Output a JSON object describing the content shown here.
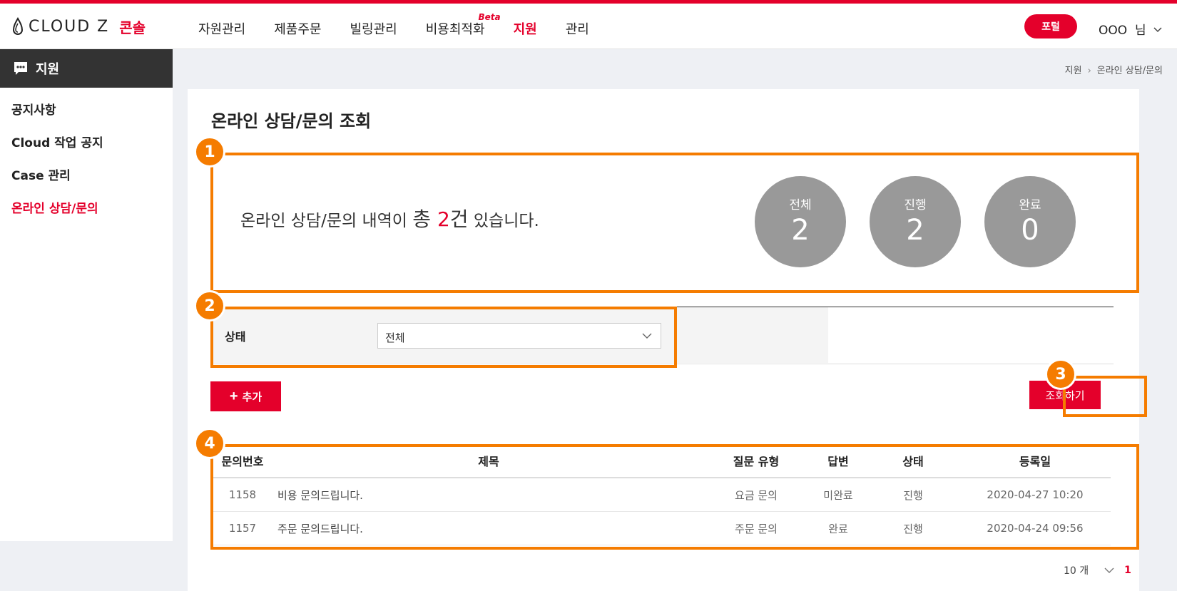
{
  "header": {
    "logo_text": "CLOUD Z",
    "logo_sub": "콘솔",
    "nav": [
      {
        "label": "자원관리"
      },
      {
        "label": "제품주문"
      },
      {
        "label": "빌링관리"
      },
      {
        "label": "비용최적화",
        "badge": "Beta"
      },
      {
        "label": "지원",
        "active": true
      },
      {
        "label": "관리"
      }
    ],
    "portal_label": "포털",
    "user_label": "OOO  님"
  },
  "sidebar": {
    "title": "지원",
    "items": [
      {
        "label": "공지사항"
      },
      {
        "label": "Cloud 작업 공지"
      },
      {
        "label": "Case 관리"
      },
      {
        "label": "온라인 상담/문의",
        "active": true
      }
    ]
  },
  "breadcrumb": {
    "parent": "지원",
    "current": "온라인 상담/문의"
  },
  "main": {
    "title": "온라인 상담/문의 조회",
    "summary": {
      "prefix": "온라인 상담/문의 내역이 ",
      "total_word": "총 ",
      "count": "2",
      "unit": "건",
      "suffix": " 있습니다."
    },
    "stats": [
      {
        "label": "전체",
        "value": "2"
      },
      {
        "label": "진행",
        "value": "2"
      },
      {
        "label": "완료",
        "value": "0"
      }
    ],
    "filter": {
      "label": "상태",
      "selected": "전체"
    },
    "add_label": "추가",
    "search_label": "조회하기",
    "table": {
      "columns": [
        "문의번호",
        "제목",
        "질문 유형",
        "답변",
        "상태",
        "등록일"
      ],
      "rows": [
        [
          "1158",
          "비용 문의드립니다.",
          "요금 문의",
          "미완료",
          "진행",
          "2020-04-27 10:20"
        ],
        [
          "1157",
          "주문 문의드립니다.",
          "주문 문의",
          "완료",
          "진행",
          "2020-04-24 09:56"
        ]
      ]
    },
    "pager": {
      "page_size": "10 개",
      "current_page": "1"
    }
  },
  "annotations": [
    "1",
    "2",
    "3",
    "4"
  ],
  "colors": {
    "brand": "#e4002b",
    "annotation": "#f57c00",
    "stat_circle": "#999999"
  }
}
